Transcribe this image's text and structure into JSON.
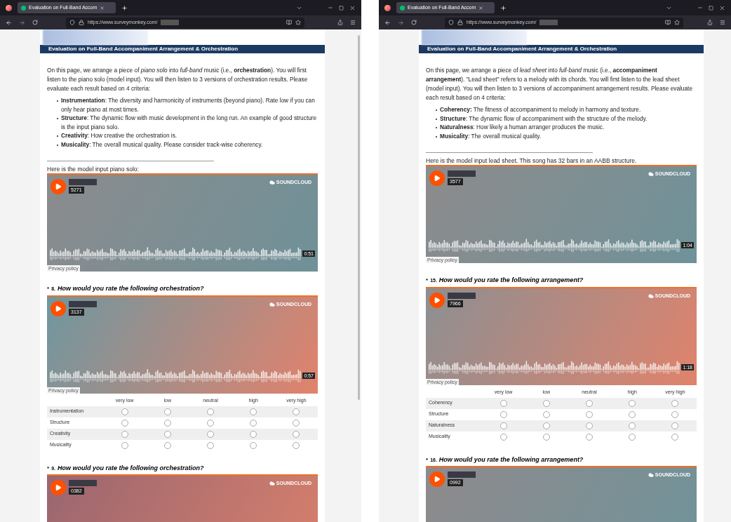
{
  "windows": [
    {
      "tab": {
        "title": "Evaluation on Full-Band Accom",
        "selected": true
      },
      "url": "https://www.surveymonkey.com/",
      "survey_title": "Evaluation on Full-Band Accompaniment Arrangement & Orchestration",
      "intro": "On this page, we arrange a piece of *piano solo* into *full-band* music (i.e., **orchestration**). You will first listen to the piano solo (model input). You will then listen to 3 versions of orchestration results. Please evaluate each result based on 4 criteria:",
      "criteria": [
        "**Instrumentation**: The diversity and harmonicity of instruments (beyond piano). Rate low if you can only hear piano at most times.",
        "**Structure**: The dynamic flow with music development in the long run. An example of good structure is the input piano solo.",
        "**Creativity**: How creative the orchestration is.",
        "**Musicality**: The overall musical quality. Please consider track-wise coherency."
      ],
      "blocks": [
        {
          "kind": "input",
          "caption": "Here is the model input piano solo:",
          "player": {
            "number": "5271",
            "brand": "SOUNDCLOUD",
            "time": "0:51",
            "privacy": "Privacy policy"
          }
        },
        {
          "kind": "question",
          "mark": "*",
          "number": "8.",
          "text": "How would you rate the following orchestration?",
          "player": {
            "number": "3137",
            "brand": "SOUNDCLOUD",
            "time": "0:57",
            "privacy": "Privacy policy"
          },
          "scale": [
            "very low",
            "low",
            "neutral",
            "high",
            "very high"
          ],
          "rows": [
            {
              "label": "Instrumentation",
              "options": [
                {
                  "selected": false
                },
                {
                  "selected": false
                },
                {
                  "selected": false
                },
                {
                  "selected": false
                },
                {
                  "selected": false
                }
              ]
            },
            {
              "label": "Structure",
              "options": [
                {
                  "selected": false
                },
                {
                  "selected": false
                },
                {
                  "selected": false
                },
                {
                  "selected": false
                },
                {
                  "selected": false
                }
              ]
            },
            {
              "label": "Creativity",
              "options": [
                {
                  "selected": false
                },
                {
                  "selected": false
                },
                {
                  "selected": false
                },
                {
                  "selected": false
                },
                {
                  "selected": false
                }
              ]
            },
            {
              "label": "Musicality",
              "options": [
                {
                  "selected": false
                },
                {
                  "selected": false
                },
                {
                  "selected": false
                },
                {
                  "selected": false
                },
                {
                  "selected": false
                }
              ]
            }
          ]
        },
        {
          "kind": "question",
          "mark": "*",
          "number": "9.",
          "text": "How would you rate the following orchestration?",
          "player": {
            "number": "0382",
            "brand": "SOUNDCLOUD"
          }
        }
      ],
      "scrollbar": true
    },
    {
      "tab": {
        "title": "Evaluation on Full-Band Accom",
        "selected": true
      },
      "url": "https://www.surveymonkey.com/",
      "survey_title": "Evaluation on Full-Band Accompaniment Arrangement & Orchestration",
      "intro": "On this page, we arrange a piece of *lead sheet* into *full-band* music (i.e., **accompaniment arrangement**). \"Lead sheet\" refers to a melody with its chords. You will first listen to the lead sheet (model input). You will then listen to 3 versions of accompaniment arrangement results. Please evaluate each result based on 4 criteria:",
      "criteria": [
        "**Coherency:** The fitness of accompaniment to melody in harmony and texture.",
        "**Structure**: The dynamic flow of accompaniment with the structure of the melody.",
        "**Naturalness**: How likely a human arranger produces the music.",
        "**Musicality**: The overall musical quality."
      ],
      "blocks": [
        {
          "kind": "input",
          "caption": "Here is the model input lead sheet. This song has 32 bars in an AABB structure.",
          "player": {
            "number": "3577",
            "brand": "SOUNDCLOUD",
            "time": "1:04",
            "privacy": "Privacy policy"
          }
        },
        {
          "kind": "question",
          "mark": "*",
          "number": "15.",
          "text": "How would you rate the following arrangement?",
          "player": {
            "number": "7966",
            "brand": "SOUNDCLOUD",
            "time": "1:18",
            "privacy": "Privacy policy"
          },
          "scale": [
            "very low",
            "low",
            "neutral",
            "high",
            "very high"
          ],
          "rows": [
            {
              "label": "Coherency",
              "options": [
                {
                  "selected": false
                },
                {
                  "selected": false
                },
                {
                  "selected": false
                },
                {
                  "selected": false
                },
                {
                  "selected": false
                }
              ]
            },
            {
              "label": "Structure",
              "options": [
                {
                  "selected": false
                },
                {
                  "selected": false
                },
                {
                  "selected": false
                },
                {
                  "selected": false
                },
                {
                  "selected": false
                }
              ]
            },
            {
              "label": "Naturalness",
              "options": [
                {
                  "selected": false
                },
                {
                  "selected": false
                },
                {
                  "selected": false
                },
                {
                  "selected": false
                },
                {
                  "selected": false
                }
              ]
            },
            {
              "label": "Musicality",
              "options": [
                {
                  "selected": false
                },
                {
                  "selected": false
                },
                {
                  "selected": false
                },
                {
                  "selected": false
                },
                {
                  "selected": false
                }
              ]
            }
          ]
        },
        {
          "kind": "question",
          "mark": "*",
          "number": "16.",
          "text": "How would you rate the following arrangement?",
          "player": {
            "number": "0992",
            "brand": "SOUNDCLOUD"
          }
        }
      ]
    }
  ]
}
